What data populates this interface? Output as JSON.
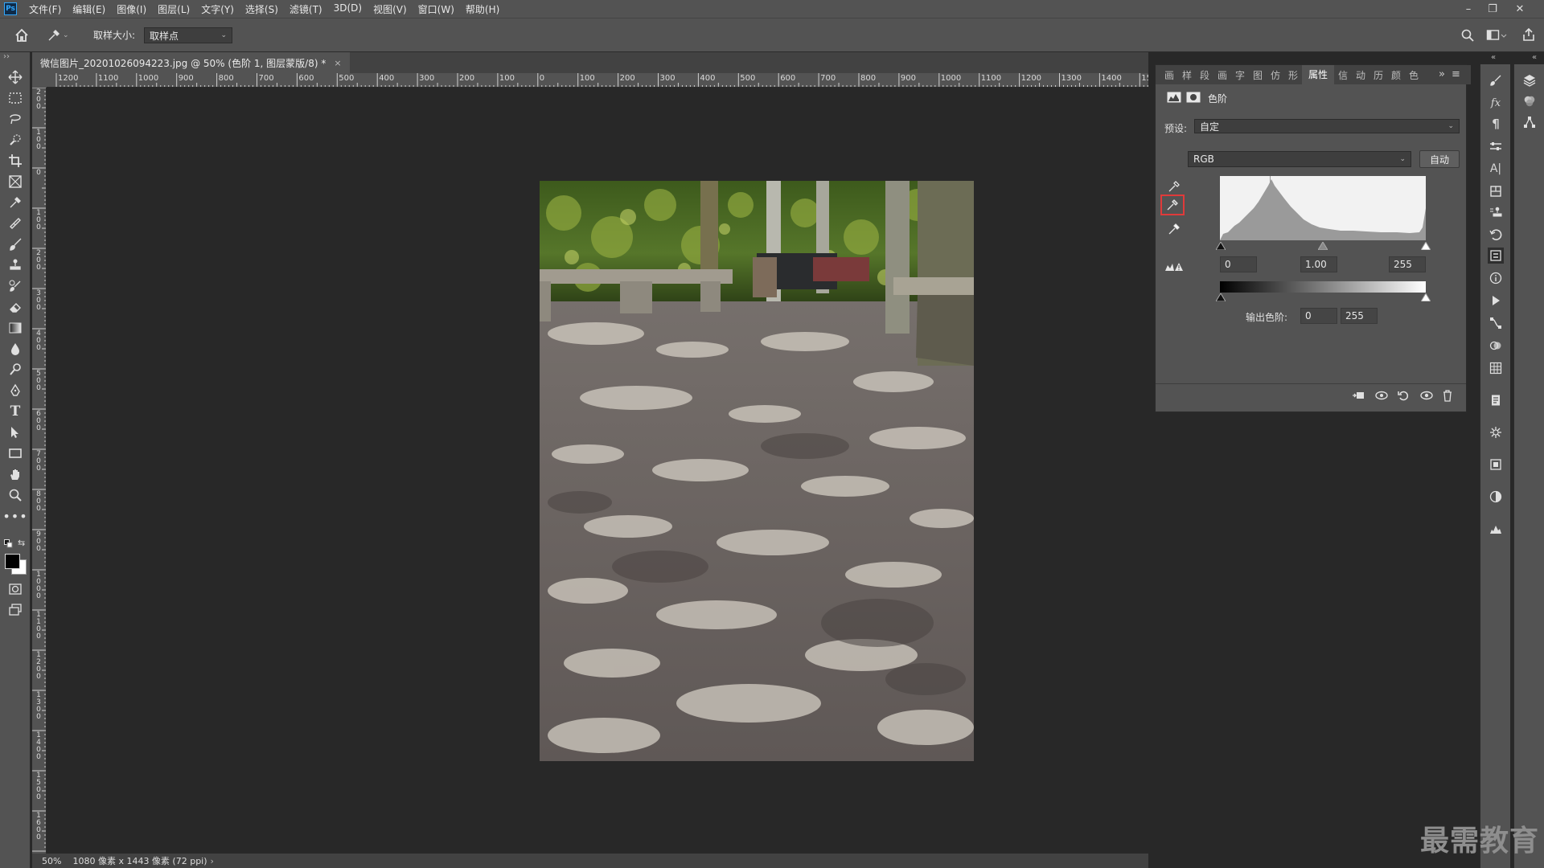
{
  "app": {
    "logo": "Ps"
  },
  "menu": {
    "items": [
      "文件(F)",
      "编辑(E)",
      "图像(I)",
      "图层(L)",
      "文字(Y)",
      "选择(S)",
      "滤镜(T)",
      "3D(D)",
      "视图(V)",
      "窗口(W)",
      "帮助(H)"
    ]
  },
  "options_bar": {
    "sample_size_label": "取样大小:",
    "sample_size_value": "取样点"
  },
  "document": {
    "tab_title": "微信图片_20201026094223.jpg @ 50% (色阶 1, 图层蒙版/8) *",
    "close_glyph": "×"
  },
  "ruler": {
    "h_labels": [
      "1200",
      "1100",
      "1000",
      "900",
      "800",
      "700",
      "600",
      "500",
      "400",
      "300",
      "200",
      "100",
      "0",
      "100",
      "200",
      "300",
      "400",
      "500",
      "600",
      "700",
      "800",
      "900",
      "1000",
      "1100",
      "1200",
      "1300",
      "1400",
      "15"
    ],
    "v_labels": [
      "200",
      "100",
      "0",
      "100",
      "200",
      "300",
      "400",
      "500",
      "600",
      "700",
      "800",
      "900",
      "1000",
      "1100",
      "1200",
      "1300",
      "1400",
      "1500",
      "1600"
    ]
  },
  "status": {
    "zoom": "50%",
    "doc_info": "1080 像素 x 1443 像素 (72 ppi)",
    "arrow": "›"
  },
  "properties": {
    "tabs": [
      "画",
      "样",
      "段",
      "画",
      "字",
      "图",
      "仿",
      "形",
      "属性",
      "信",
      "动",
      "历",
      "颜",
      "色"
    ],
    "active_tab": "属性",
    "overflow": "»",
    "menu_glyph": "≡",
    "adjustment_title": "色阶",
    "preset_label": "预设:",
    "preset_value": "自定",
    "channel_value": "RGB",
    "auto_button": "自动",
    "input_black": "0",
    "input_gamma": "1.00",
    "input_white": "255",
    "output_label": "输出色阶:",
    "output_black": "0",
    "output_white": "255"
  },
  "colors": {
    "panel_bg": "#535353",
    "canvas_bg": "#282828",
    "dark_chrome": "#424242",
    "highlight_red": "#e03a3a",
    "ps_blue": "#31a8ff"
  },
  "watermark": "最需教育"
}
